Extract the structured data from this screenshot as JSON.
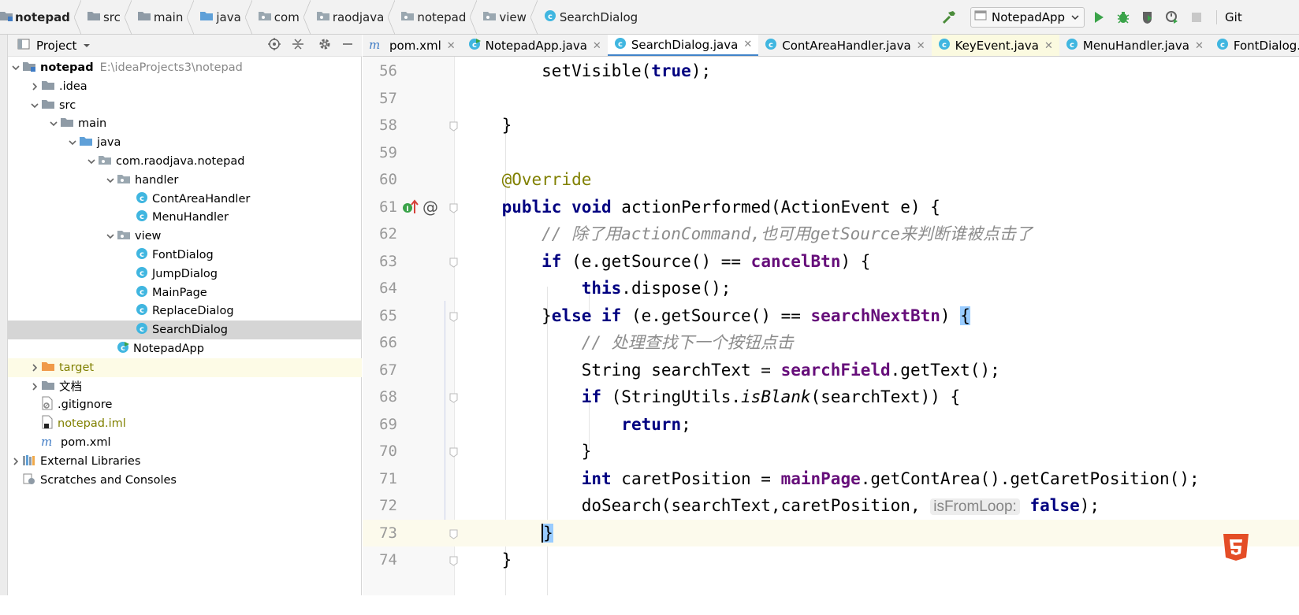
{
  "breadcrumb": [
    {
      "label": "notepad",
      "icon": "module-folder-icon"
    },
    {
      "label": "src",
      "icon": "folder-icon"
    },
    {
      "label": "main",
      "icon": "folder-icon"
    },
    {
      "label": "java",
      "icon": "source-folder-icon"
    },
    {
      "label": "com",
      "icon": "package-icon"
    },
    {
      "label": "raodjava",
      "icon": "package-icon"
    },
    {
      "label": "notepad",
      "icon": "package-icon"
    },
    {
      "label": "view",
      "icon": "package-icon"
    },
    {
      "label": "SearchDialog",
      "icon": "class-icon"
    }
  ],
  "toolbar": {
    "run_config": "NotepadApp",
    "vcs_label": "Git"
  },
  "project_panel": {
    "title": "Project",
    "tree": [
      {
        "label": "notepad",
        "path": "E:\\ideaProjects3\\notepad",
        "depth": 0,
        "arrow": "expanded",
        "icon": "module-folder",
        "bold": true
      },
      {
        "label": ".idea",
        "depth": 1,
        "arrow": "collapsed",
        "icon": "folder"
      },
      {
        "label": "src",
        "depth": 1,
        "arrow": "expanded",
        "icon": "folder"
      },
      {
        "label": "main",
        "depth": 2,
        "arrow": "expanded",
        "icon": "folder"
      },
      {
        "label": "java",
        "depth": 3,
        "arrow": "expanded",
        "icon": "source-folder"
      },
      {
        "label": "com.raodjava.notepad",
        "depth": 4,
        "arrow": "expanded",
        "icon": "package"
      },
      {
        "label": "handler",
        "depth": 5,
        "arrow": "expanded",
        "icon": "package"
      },
      {
        "label": "ContAreaHandler",
        "depth": 6,
        "arrow": "",
        "icon": "class"
      },
      {
        "label": "MenuHandler",
        "depth": 6,
        "arrow": "",
        "icon": "class"
      },
      {
        "label": "view",
        "depth": 5,
        "arrow": "expanded",
        "icon": "package"
      },
      {
        "label": "FontDialog",
        "depth": 6,
        "arrow": "",
        "icon": "class"
      },
      {
        "label": "JumpDialog",
        "depth": 6,
        "arrow": "",
        "icon": "class"
      },
      {
        "label": "MainPage",
        "depth": 6,
        "arrow": "",
        "icon": "class"
      },
      {
        "label": "ReplaceDialog",
        "depth": 6,
        "arrow": "",
        "icon": "class"
      },
      {
        "label": "SearchDialog",
        "depth": 6,
        "arrow": "",
        "icon": "class",
        "selected": true
      },
      {
        "label": "NotepadApp",
        "depth": 5,
        "arrow": "",
        "icon": "main-class"
      },
      {
        "label": "target",
        "depth": 1,
        "arrow": "collapsed",
        "icon": "excluded-folder",
        "highlight": true,
        "olive": true
      },
      {
        "label": "文档",
        "depth": 1,
        "arrow": "collapsed",
        "icon": "folder"
      },
      {
        "label": ".gitignore",
        "depth": 1,
        "arrow": "",
        "icon": "ignore-file"
      },
      {
        "label": "notepad.iml",
        "depth": 1,
        "arrow": "",
        "icon": "iml-file",
        "olive": true
      },
      {
        "label": "pom.xml",
        "depth": 1,
        "arrow": "",
        "icon": "maven-file"
      },
      {
        "label": "External Libraries",
        "depth": 0,
        "arrow": "collapsed",
        "icon": "libraries"
      },
      {
        "label": "Scratches and Consoles",
        "depth": 0,
        "arrow": "",
        "icon": "scratches"
      }
    ]
  },
  "tabs": [
    {
      "label": "pom.xml",
      "icon": "maven-file-icon"
    },
    {
      "label": "NotepadApp.java",
      "icon": "main-class-icon"
    },
    {
      "label": "SearchDialog.java",
      "icon": "class-icon",
      "active": true
    },
    {
      "label": "ContAreaHandler.java",
      "icon": "class-icon"
    },
    {
      "label": "KeyEvent.java",
      "icon": "class-icon"
    },
    {
      "label": "MenuHandler.java",
      "icon": "class-icon"
    },
    {
      "label": "FontDialog.java",
      "icon": "class-icon"
    }
  ],
  "editor": {
    "caret_line": 73,
    "lines": [
      {
        "n": "56",
        "parts": [
          [
            "        ",
            ""
          ],
          [
            "setVisible(",
            ""
          ],
          [
            "true",
            "kw"
          ],
          [
            ");",
            ""
          ]
        ]
      },
      {
        "n": "57",
        "parts": []
      },
      {
        "n": "58",
        "parts": [
          [
            "    }",
            ""
          ]
        ]
      },
      {
        "n": "59",
        "parts": []
      },
      {
        "n": "60",
        "parts": [
          [
            "    ",
            ""
          ],
          [
            "@Override",
            "ann"
          ]
        ]
      },
      {
        "n": "61",
        "parts": [
          [
            "    ",
            ""
          ],
          [
            "public void ",
            "kw"
          ],
          [
            "actionPerformed(ActionEvent e) {",
            ""
          ]
        ]
      },
      {
        "n": "62",
        "parts": [
          [
            "        ",
            ""
          ],
          [
            "// 除了用actionCommand,也可用getSource来判断谁被点击了",
            "cmt"
          ]
        ]
      },
      {
        "n": "63",
        "parts": [
          [
            "        ",
            ""
          ],
          [
            "if ",
            "kw"
          ],
          [
            "(e.getSource() == ",
            ""
          ],
          [
            "cancelBtn",
            "fld"
          ],
          [
            ") {",
            ""
          ]
        ]
      },
      {
        "n": "64",
        "parts": [
          [
            "            ",
            ""
          ],
          [
            "this",
            "kw"
          ],
          [
            ".dispose();",
            ""
          ]
        ]
      },
      {
        "n": "65",
        "parts": [
          [
            "        }",
            ""
          ],
          [
            "else if ",
            "kw"
          ],
          [
            "(e.getSource() == ",
            ""
          ],
          [
            "searchNextBtn",
            "fld"
          ],
          [
            ") ",
            ""
          ],
          [
            "{",
            "brace-hl"
          ]
        ]
      },
      {
        "n": "66",
        "parts": [
          [
            "            ",
            ""
          ],
          [
            "// 处理查找下一个按钮点击",
            "cmt"
          ]
        ]
      },
      {
        "n": "67",
        "parts": [
          [
            "            String searchText = ",
            ""
          ],
          [
            "searchField",
            "fld"
          ],
          [
            ".getText();",
            ""
          ]
        ]
      },
      {
        "n": "68",
        "parts": [
          [
            "            ",
            ""
          ],
          [
            "if ",
            "kw"
          ],
          [
            "(StringUtils.",
            ""
          ],
          [
            "isBlank",
            "ital"
          ],
          [
            "(searchText)) {",
            ""
          ]
        ]
      },
      {
        "n": "69",
        "parts": [
          [
            "                ",
            ""
          ],
          [
            "return",
            "kw"
          ],
          [
            ";",
            ""
          ]
        ]
      },
      {
        "n": "70",
        "parts": [
          [
            "            }",
            ""
          ]
        ]
      },
      {
        "n": "71",
        "parts": [
          [
            "            ",
            ""
          ],
          [
            "int ",
            "kw"
          ],
          [
            "caretPosition = ",
            ""
          ],
          [
            "mainPage",
            "fld"
          ],
          [
            ".getContArea().getCaretPosition();",
            ""
          ]
        ]
      },
      {
        "n": "72",
        "parts": [
          [
            "            doSearch(searchText,caretPosition, ",
            ""
          ],
          [
            "isFromLoop:",
            "hint"
          ],
          [
            " ",
            ""
          ],
          [
            "false",
            "kw"
          ],
          [
            ");",
            ""
          ]
        ]
      },
      {
        "n": "73",
        "parts": [
          [
            "        ",
            ""
          ],
          [
            "}",
            "brace-hl caret"
          ]
        ]
      },
      {
        "n": "74",
        "parts": [
          [
            "    }",
            ""
          ]
        ]
      }
    ]
  },
  "colors": {
    "keyword": "#000080",
    "field": "#660e7a",
    "annotation": "#808000",
    "comment": "#8c8c8c",
    "brace_highlight": "#99ccff",
    "active_tab_underline": "#4083c9"
  }
}
